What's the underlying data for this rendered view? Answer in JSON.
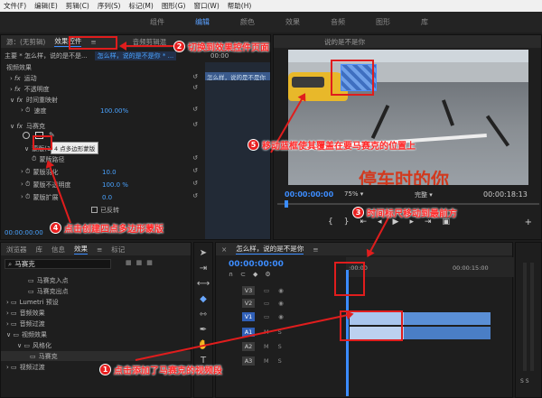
{
  "menu": [
    "文件(F)",
    "编辑(E)",
    "剪辑(C)",
    "序列(S)",
    "标记(M)",
    "图形(G)",
    "窗口(W)",
    "帮助(H)"
  ],
  "workspace_tabs": [
    "组件",
    "编辑",
    "颜色",
    "效果",
    "音频",
    "图形",
    "库"
  ],
  "workspace_selected": "编辑",
  "source_panel": {
    "label": "源：(无剪辑)",
    "active_tab": "效果控件",
    "tab3": "音频剪辑混",
    "program_clip": "说的是不是你"
  },
  "effect_controls": {
    "clip_path": "主要 * 怎么样，说的是不是...",
    "clip_path_blue": "怎么样，说的是不是你 * ...",
    "timecode_top": "00:00",
    "video_effects": "视频效果",
    "motion": "运动",
    "opacity": "不透明度",
    "time_remap": "时间重映射",
    "speed_label": "速度",
    "speed_value": "100.00%",
    "mosaic": "马赛克",
    "tooltip": "4 点多边形蒙版",
    "mask": "蒙版(1)",
    "mask_path": "蒙版路径",
    "mask_feather": "蒙版羽化",
    "mask_feather_value": "10.0",
    "mask_opacity": "蒙版不透明度",
    "mask_opacity_value": "100.0 %",
    "mask_expansion": "蒙版扩展",
    "mask_expansion_value": "0.0",
    "invert": "已反转",
    "timecode": "00:00:00:00",
    "fx_clip": "怎么样，说的是不是你"
  },
  "program_monitor": {
    "timecode": "00:00:00:00",
    "zoom": "75%",
    "quality": "完整",
    "duration": "00:00:18:13",
    "caption": "停车时的你"
  },
  "project_panel": {
    "tabs": [
      "浏览器",
      "库",
      "信息",
      "效果",
      "标记"
    ],
    "search": "马赛克",
    "items": [
      "马赛克入点",
      "马赛克出点",
      "Lumetri 预设",
      "音频效果",
      "音频过渡",
      "视频效果",
      "风格化",
      "马赛克",
      "视频过渡"
    ]
  },
  "timeline": {
    "title": "怎么样，说的是不是你",
    "timecode": "00:00:00:00",
    "ruler_start": ":00:00",
    "ruler_mid": "00:00:15:00",
    "tracks": [
      "V3",
      "V2",
      "V1",
      "A1",
      "A2",
      "A3"
    ]
  },
  "annotations": {
    "a1": {
      "n": "1",
      "text": "点击添加了马赛克的视频段"
    },
    "a2": {
      "n": "2",
      "text": "切换到效果控件页面"
    },
    "a3": {
      "n": "3",
      "text": "时间标尺移动到最前方"
    },
    "a4": {
      "n": "4",
      "text": "点击创建四点多边形蒙版"
    },
    "a5": {
      "n": "5",
      "text": "移动蓝框使其覆盖在要马赛克的位置上"
    }
  },
  "colors": {
    "accent": "#3b8cff",
    "annotation": "#e01d1d",
    "clip_blue": "#5a8fd6"
  }
}
